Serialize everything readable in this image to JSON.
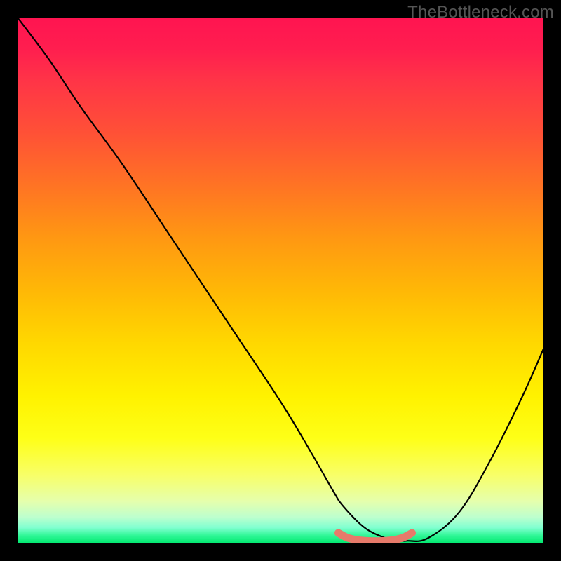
{
  "watermark": "TheBottleneck.com",
  "chart_data": {
    "type": "line",
    "title": "",
    "xlabel": "",
    "ylabel": "",
    "xlim": [
      0,
      100
    ],
    "ylim": [
      0,
      100
    ],
    "series": [
      {
        "name": "bottleneck-curve",
        "x": [
          0,
          6,
          12,
          20,
          30,
          40,
          50,
          56,
          60,
          62,
          66,
          70,
          72,
          74,
          78,
          84,
          90,
          96,
          100
        ],
        "values": [
          100,
          92,
          83,
          72,
          57,
          42,
          27,
          17,
          10,
          7,
          3,
          1,
          0.5,
          0.5,
          1,
          6,
          16,
          28,
          37
        ]
      },
      {
        "name": "optimal-range-marker",
        "x": [
          61,
          63,
          66,
          70,
          73,
          75
        ],
        "values": [
          2,
          1,
          0.5,
          0.5,
          1,
          2
        ]
      }
    ],
    "gradient_stops": [
      {
        "pct": 0,
        "color": "#ff1450"
      },
      {
        "pct": 6,
        "color": "#ff1e4f"
      },
      {
        "pct": 12,
        "color": "#ff3447"
      },
      {
        "pct": 22,
        "color": "#ff5136"
      },
      {
        "pct": 33,
        "color": "#ff7722"
      },
      {
        "pct": 42,
        "color": "#ff9812"
      },
      {
        "pct": 52,
        "color": "#ffb806"
      },
      {
        "pct": 62,
        "color": "#ffd800"
      },
      {
        "pct": 72,
        "color": "#fff200"
      },
      {
        "pct": 80,
        "color": "#feff17"
      },
      {
        "pct": 87,
        "color": "#f8ff68"
      },
      {
        "pct": 92,
        "color": "#e5ffad"
      },
      {
        "pct": 95,
        "color": "#bdffce"
      },
      {
        "pct": 97,
        "color": "#80ffd0"
      },
      {
        "pct": 98.5,
        "color": "#30f797"
      },
      {
        "pct": 100,
        "color": "#00e86e"
      }
    ],
    "marker_color": "#e77a6a",
    "curve_color": "#000000"
  }
}
